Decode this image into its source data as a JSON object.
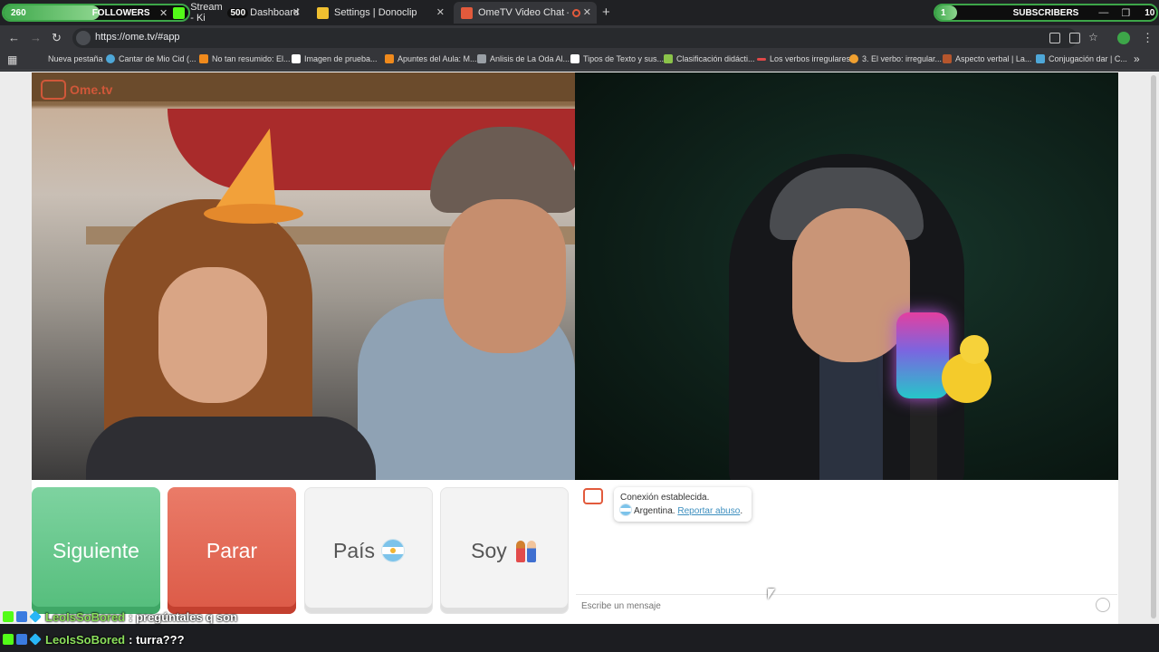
{
  "browser": {
    "tabs": [
      {
        "label": "Stream - Ki",
        "label2": "Dashboard",
        "color": "#53fc18"
      },
      {
        "label": "Settings | Donoclip",
        "color": "#f0c030"
      },
      {
        "label": "OmeTV Video Chat — Ome",
        "color": "#e25a3c"
      }
    ],
    "new_tab": "+",
    "url": "https://ome.tv/#app",
    "bookmarks": [
      {
        "label": "Nueva pestaña",
        "color": "#5f6368"
      },
      {
        "label": "Cantar de Mio Cid (...",
        "color": "#4ea7d8"
      },
      {
        "label": "No tan resumido: El...",
        "color": "#f08a1c"
      },
      {
        "label": "Imagen de prueba...",
        "color": "#ffffff"
      },
      {
        "label": "Apuntes del Aula: M...",
        "color": "#f08a1c"
      },
      {
        "label": "Anlisis de La Oda Al...",
        "color": "#9aa0a6"
      },
      {
        "label": "Tipos de Texto y sus...",
        "color": "#ffffff"
      },
      {
        "label": "Clasificación didácti...",
        "color": "#8bc34a"
      },
      {
        "label": "Los verbos irregulares",
        "color": "#e04848"
      },
      {
        "label": "3. El verbo: irregular...",
        "color": "#f0a030"
      },
      {
        "label": "Aspecto verbal | La...",
        "color": "#b5562d"
      },
      {
        "label": "Conjugación dar | C...",
        "color": "#4ea7d8"
      }
    ],
    "more_bookmarks": "»"
  },
  "overlays": {
    "followers": {
      "count": "260",
      "label": "FOLLOWERS",
      "goal": "500",
      "progress": 0.52
    },
    "subscribers": {
      "count": "1",
      "label": "SUBSCRIBERS",
      "goal": "10",
      "progress": 0.1
    }
  },
  "ometv": {
    "logo": "Ome.tv",
    "buttons": {
      "next": "Siguiente",
      "stop": "Parar",
      "country": "País",
      "gender": "Soy"
    },
    "chat": {
      "status": "Conexión establecida.",
      "country": "Argentina.",
      "report": "Reportar abuso",
      "report_suffix": ".",
      "placeholder": "Escribe un mensaje"
    }
  },
  "stream_chat": [
    {
      "user": "LeoIsSoBored",
      "message": ": pregúntales q son"
    },
    {
      "user": "LeoIsSoBored",
      "message": ": turra???"
    }
  ]
}
